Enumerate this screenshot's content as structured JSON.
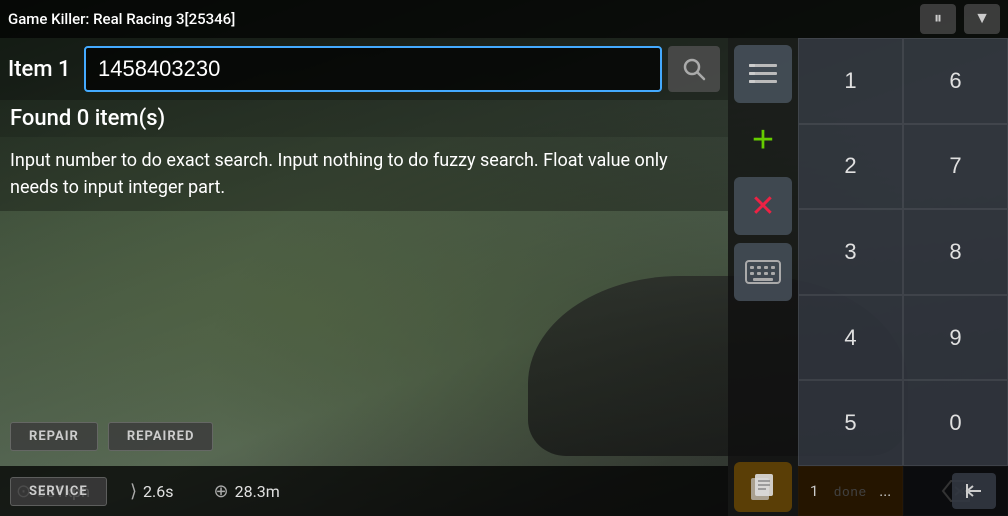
{
  "titleBar": {
    "title": "Game Killer: Real Racing 3[25346]",
    "pauseIcon": "⏸",
    "dropdownIcon": "▼"
  },
  "searchRow": {
    "itemLabel": "Item 1",
    "inputValue": "1458403230",
    "inputPlaceholder": "",
    "searchIconUnicode": "🔍"
  },
  "foundText": "Found 0 item(s)",
  "infoText": "Input number to do exact search. Input nothing to do fuzzy search. Float value only needs to input integer part.",
  "statusBar": {
    "speed": "351kph",
    "time": "2.6s",
    "distance": "28.3m",
    "pages": "1",
    "moreLabel": "..."
  },
  "controls": {
    "listIcon": "≡",
    "addIcon": "+",
    "deleteIcon": "✕",
    "keyboardIcon": "⌨",
    "pagesIcon": "📋"
  },
  "numpad": {
    "keys": [
      "1",
      "6",
      "2",
      "7",
      "3",
      "8",
      "4",
      "9",
      "5",
      "0"
    ],
    "bottomLeft": "done",
    "bottomRight": "◀|"
  },
  "repairButtons": {
    "repair": "REPAIR",
    "repaired": "REPAIRED",
    "service": "SERVICE"
  },
  "colors": {
    "accent": "#44aaff",
    "addGreen": "#66cc00",
    "deleteRed": "#ee2244",
    "orange": "#cc6600"
  }
}
